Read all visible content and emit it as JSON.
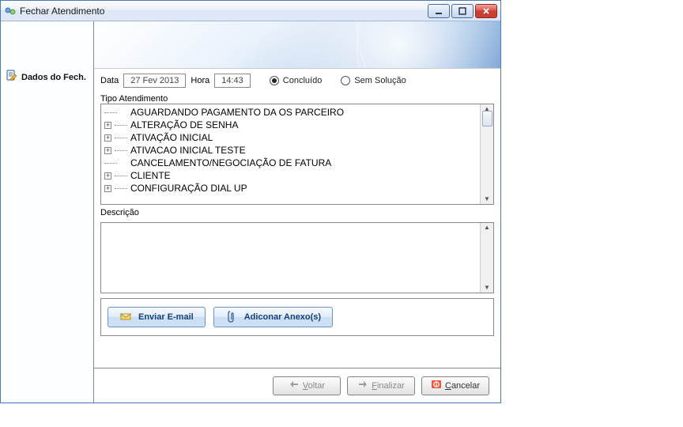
{
  "window": {
    "title": "Fechar Atendimento"
  },
  "sidebar": {
    "items": [
      {
        "label": "Dados do Fech."
      }
    ]
  },
  "form": {
    "date_label": "Data",
    "date_value": "27 Fev 2013",
    "time_label": "Hora",
    "time_value": "14:43",
    "status_options": {
      "concluido": "Concluído",
      "sem_solucao": "Sem Solução"
    },
    "status_selected": "concluido",
    "tipo_label": "Tipo Atendimento",
    "tree": [
      {
        "label": "AGUARDANDO PAGAMENTO DA OS PARCEIRO",
        "expandable": false
      },
      {
        "label": "ALTERAÇÃO DE SENHA",
        "expandable": true
      },
      {
        "label": "ATIVAÇÃO INICIAL",
        "expandable": true
      },
      {
        "label": "ATIVACAO INICIAL TESTE",
        "expandable": true
      },
      {
        "label": "CANCELAMENTO/NEGOCIAÇÃO DE FATURA",
        "expandable": false
      },
      {
        "label": "CLIENTE",
        "expandable": true
      },
      {
        "label": "CONFIGURAÇÃO DIAL UP",
        "expandable": true
      }
    ],
    "descricao_label": "Descrição"
  },
  "actions": {
    "email_label": "Enviar E-mail",
    "attach_label": "Adiconar Anexo(s)"
  },
  "footer": {
    "voltar": "Voltar",
    "finalizar": "Finalizar",
    "cancelar": "Cancelar"
  }
}
